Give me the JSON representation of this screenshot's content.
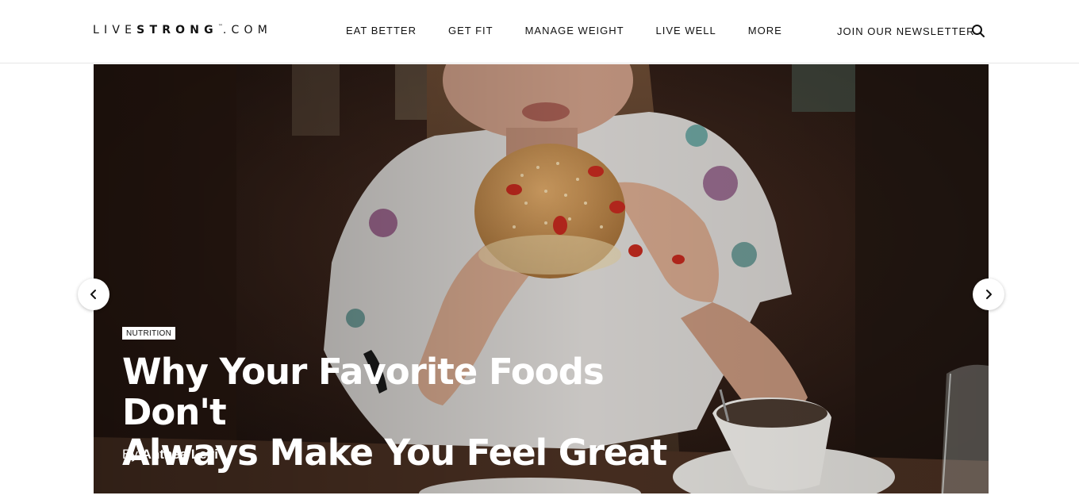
{
  "header": {
    "logo": {
      "part1": "LIVE",
      "part2": "STRONG",
      "tm": "™",
      "part3": ".COM"
    },
    "nav": [
      {
        "label": "EAT BETTER"
      },
      {
        "label": "GET FIT"
      },
      {
        "label": "MANAGE WEIGHT"
      },
      {
        "label": "LIVE WELL"
      },
      {
        "label": "MORE"
      }
    ],
    "newsletter_label": "JOIN OUR NEWSLETTER",
    "search_icon": "search-icon"
  },
  "hero": {
    "image": "woman-eating-burger-photo",
    "category": "NUTRITION",
    "headline_line1": "Why Your Favorite Foods Don't",
    "headline_line2": "Always Make You Feel Great",
    "byline_prefix": "By",
    "author": "Anthea Levi",
    "prev_icon": "chevron-left-icon",
    "next_icon": "chevron-right-icon"
  },
  "colors": {
    "text": "#111111",
    "background": "#ffffff",
    "hero_dark": "#241611"
  }
}
